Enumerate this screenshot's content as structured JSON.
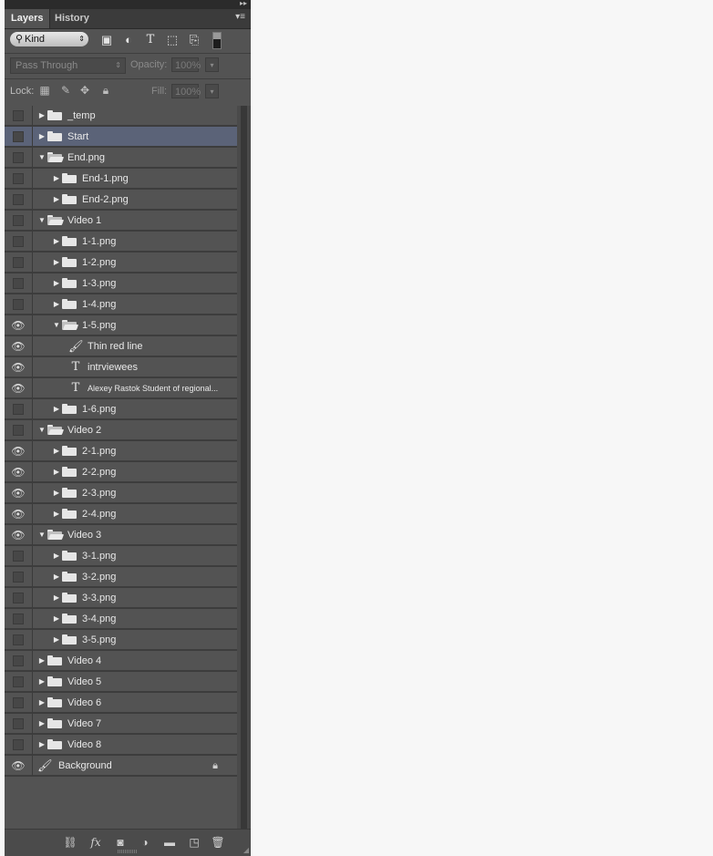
{
  "panel": {
    "tabs": [
      {
        "label": "Layers"
      },
      {
        "label": "History"
      }
    ],
    "collapse_icon": "double-chevron-right-icon",
    "menu_icon": "panel-menu-icon"
  },
  "filter": {
    "kind_label": "Kind",
    "icons": [
      "pixel-layer-filter-icon",
      "adjustment-layer-filter-icon",
      "type-layer-filter-icon",
      "shape-layer-filter-icon",
      "smart-object-filter-icon"
    ]
  },
  "blend": {
    "mode": "Pass Through",
    "opacity_label": "Opacity:",
    "opacity_value": "100%"
  },
  "lock": {
    "label": "Lock:",
    "fill_label": "Fill:",
    "fill_value": "100%"
  },
  "layers": [
    {
      "name": "_temp",
      "type": "folder",
      "indent": 0,
      "expanded": false,
      "visible": false
    },
    {
      "name": "Start",
      "type": "folder",
      "indent": 0,
      "expanded": false,
      "visible": false,
      "selected": true
    },
    {
      "name": "End.png",
      "type": "folder",
      "indent": 0,
      "expanded": true,
      "visible": false
    },
    {
      "name": "End-1.png",
      "type": "folder",
      "indent": 1,
      "expanded": false,
      "visible": false
    },
    {
      "name": "End-2.png",
      "type": "folder",
      "indent": 1,
      "expanded": false,
      "visible": false
    },
    {
      "name": "Video 1",
      "type": "folder",
      "indent": 0,
      "expanded": true,
      "visible": false
    },
    {
      "name": "1-1.png",
      "type": "folder",
      "indent": 1,
      "expanded": false,
      "visible": false
    },
    {
      "name": "1-2.png",
      "type": "folder",
      "indent": 1,
      "expanded": false,
      "visible": false
    },
    {
      "name": "1-3.png",
      "type": "folder",
      "indent": 1,
      "expanded": false,
      "visible": false
    },
    {
      "name": "1-4.png",
      "type": "folder",
      "indent": 1,
      "expanded": false,
      "visible": false
    },
    {
      "name": "1-5.png",
      "type": "folder",
      "indent": 1,
      "expanded": true,
      "visible": true
    },
    {
      "name": "Thin red line",
      "type": "brush",
      "indent": 2,
      "visible": true
    },
    {
      "name": "intrviewees",
      "type": "text",
      "indent": 2,
      "visible": true
    },
    {
      "name": "Alexey Rastok Student of regional...",
      "type": "text",
      "indent": 2,
      "visible": true,
      "small": true
    },
    {
      "name": "1-6.png",
      "type": "folder",
      "indent": 1,
      "expanded": false,
      "visible": false
    },
    {
      "name": "Video 2",
      "type": "folder",
      "indent": 0,
      "expanded": true,
      "visible": false
    },
    {
      "name": "2-1.png",
      "type": "folder",
      "indent": 1,
      "expanded": false,
      "visible": true
    },
    {
      "name": "2-2.png",
      "type": "folder",
      "indent": 1,
      "expanded": false,
      "visible": true
    },
    {
      "name": "2-3.png",
      "type": "folder",
      "indent": 1,
      "expanded": false,
      "visible": true
    },
    {
      "name": "2-4.png",
      "type": "folder",
      "indent": 1,
      "expanded": false,
      "visible": true
    },
    {
      "name": "Video 3",
      "type": "folder",
      "indent": 0,
      "expanded": true,
      "visible": true
    },
    {
      "name": "3-1.png",
      "type": "folder",
      "indent": 1,
      "expanded": false,
      "visible": false
    },
    {
      "name": "3-2.png",
      "type": "folder",
      "indent": 1,
      "expanded": false,
      "visible": false
    },
    {
      "name": "3-3.png",
      "type": "folder",
      "indent": 1,
      "expanded": false,
      "visible": false
    },
    {
      "name": "3-4.png",
      "type": "folder",
      "indent": 1,
      "expanded": false,
      "visible": false
    },
    {
      "name": "3-5.png",
      "type": "folder",
      "indent": 1,
      "expanded": false,
      "visible": false
    },
    {
      "name": "Video 4",
      "type": "folder",
      "indent": 0,
      "expanded": false,
      "visible": false
    },
    {
      "name": "Video 5",
      "type": "folder",
      "indent": 0,
      "expanded": false,
      "visible": false
    },
    {
      "name": "Video 6",
      "type": "folder",
      "indent": 0,
      "expanded": false,
      "visible": false
    },
    {
      "name": "Video 7",
      "type": "folder",
      "indent": 0,
      "expanded": false,
      "visible": false
    },
    {
      "name": "Video 8",
      "type": "folder",
      "indent": 0,
      "expanded": false,
      "visible": false
    },
    {
      "name": "Background",
      "type": "background",
      "indent": 0,
      "visible": true,
      "locked": true
    }
  ],
  "bottom_toolbar": [
    "link-layers-icon",
    "fx-icon",
    "layer-mask-icon",
    "adjustment-layer-icon",
    "new-group-icon",
    "new-layer-icon",
    "trash-icon"
  ],
  "colors": {
    "panel_bg": "#535353",
    "selected_row": "#5b6378",
    "list_bg": "#3c3c3c"
  }
}
